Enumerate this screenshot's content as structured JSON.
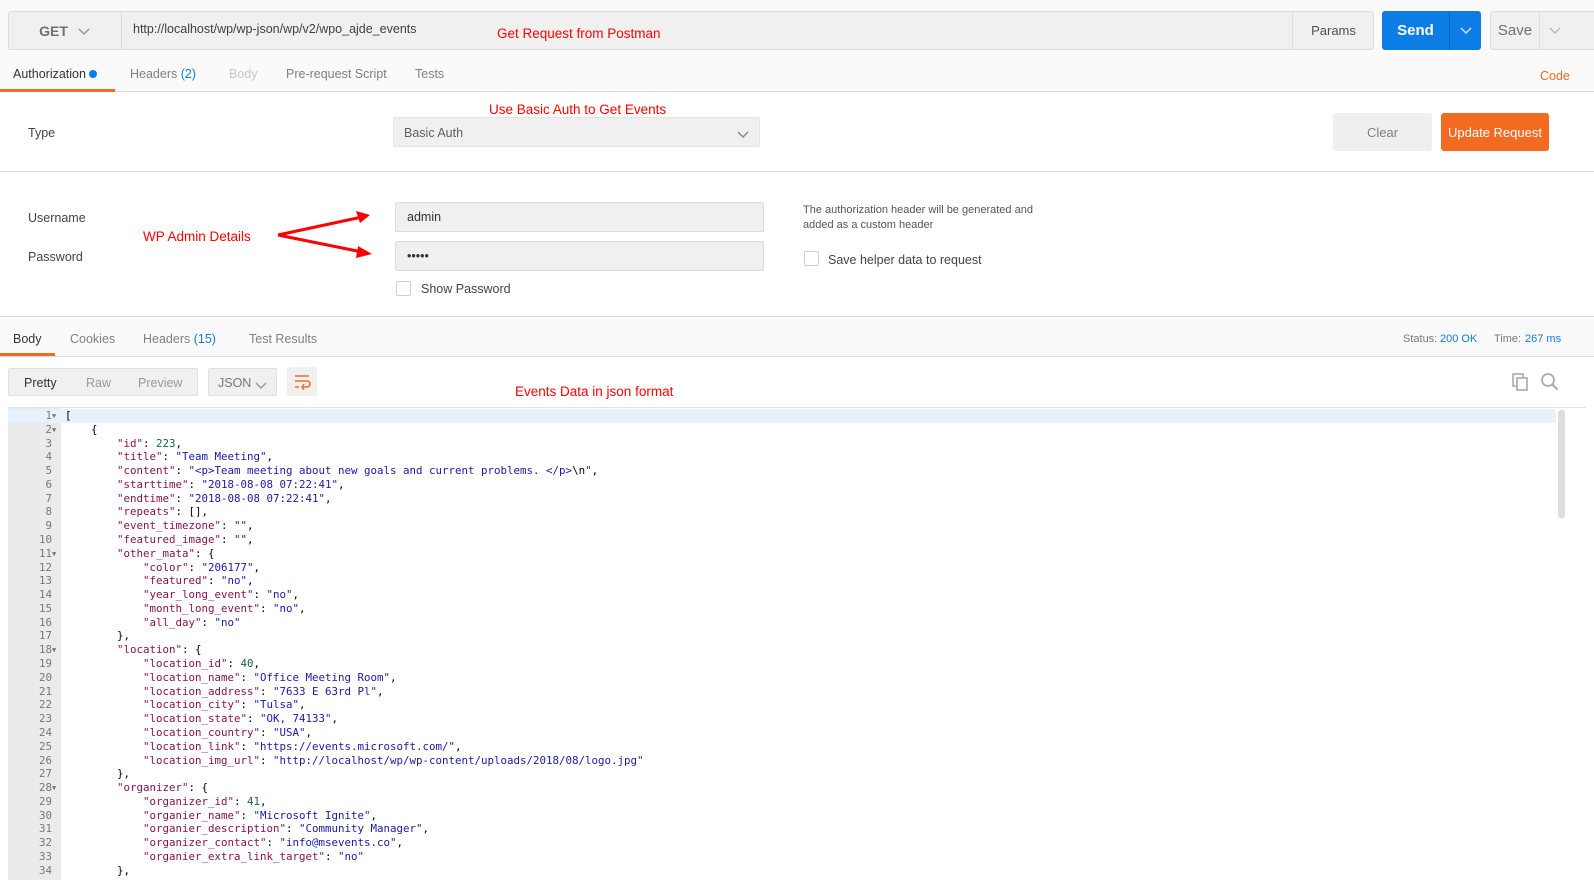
{
  "request": {
    "method": "GET",
    "url": "http://localhost/wp/wp-json/wp/v2/wpo_ajde_events",
    "params_label": "Params",
    "send_label": "Send",
    "save_label": "Save",
    "code_link": "Code"
  },
  "request_tabs": [
    {
      "label": "Authorization"
    },
    {
      "label": "Headers",
      "count": "(2)"
    },
    {
      "label": "Body"
    },
    {
      "label": "Pre-request Script"
    },
    {
      "label": "Tests"
    }
  ],
  "auth": {
    "type_label": "Type",
    "type_value": "Basic Auth",
    "clear_label": "Clear",
    "update_label": "Update Request",
    "username_label": "Username",
    "username_value": "admin",
    "password_label": "Password",
    "password_value": "•••••",
    "show_password_label": "Show Password",
    "helper_note": "The authorization header will be generated and added as a custom header",
    "save_helper_label": "Save helper data to request"
  },
  "annotations": {
    "top": "Get Request from Postman",
    "auth": "Use Basic Auth to Get Events",
    "admin": "WP Admin Details",
    "events": "Events Data in json format"
  },
  "response_tabs": [
    {
      "label": "Body"
    },
    {
      "label": "Cookies"
    },
    {
      "label": "Headers",
      "count": "(15)"
    },
    {
      "label": "Test Results"
    }
  ],
  "status": {
    "status_label": "Status:",
    "status_value": "200 OK",
    "time_label": "Time:",
    "time_value": "267 ms"
  },
  "view": {
    "modes": [
      "Pretty",
      "Raw",
      "Preview"
    ],
    "format": "JSON"
  },
  "colors": {
    "accent": "#f26b21",
    "primary": "#0d7de6",
    "annotation": "#ff0000"
  },
  "code": {
    "lines": [
      {
        "n": "1",
        "f": 1,
        "i": 0,
        "t": [
          [
            "p",
            "["
          ]
        ]
      },
      {
        "n": "2",
        "f": 1,
        "i": 1,
        "t": [
          [
            "p",
            "{"
          ]
        ]
      },
      {
        "n": "3",
        "i": 2,
        "t": [
          [
            "k",
            "\"id\""
          ],
          [
            "p",
            ": "
          ],
          [
            "n",
            "223"
          ],
          [
            "p",
            ","
          ]
        ]
      },
      {
        "n": "4",
        "i": 2,
        "t": [
          [
            "k",
            "\"title\""
          ],
          [
            "p",
            ": "
          ],
          [
            "s",
            "\"Team Meeting\""
          ],
          [
            "p",
            ","
          ]
        ]
      },
      {
        "n": "5",
        "i": 2,
        "t": [
          [
            "k",
            "\"content\""
          ],
          [
            "p",
            ": "
          ],
          [
            "s",
            "\"<p>Team meeting about new goals and current problems. </p>"
          ],
          [
            "p",
            "\\n"
          ],
          [
            "s",
            "\""
          ],
          [
            "p",
            ","
          ]
        ]
      },
      {
        "n": "6",
        "i": 2,
        "t": [
          [
            "k",
            "\"starttime\""
          ],
          [
            "p",
            ": "
          ],
          [
            "s",
            "\"2018-08-08 07:22:41\""
          ],
          [
            "p",
            ","
          ]
        ]
      },
      {
        "n": "7",
        "i": 2,
        "t": [
          [
            "k",
            "\"endtime\""
          ],
          [
            "p",
            ": "
          ],
          [
            "s",
            "\"2018-08-08 07:22:41\""
          ],
          [
            "p",
            ","
          ]
        ]
      },
      {
        "n": "8",
        "i": 2,
        "t": [
          [
            "k",
            "\"repeats\""
          ],
          [
            "p",
            ": [],"
          ]
        ]
      },
      {
        "n": "9",
        "i": 2,
        "t": [
          [
            "k",
            "\"event_timezone\""
          ],
          [
            "p",
            ": "
          ],
          [
            "s",
            "\"\""
          ],
          [
            "p",
            ","
          ]
        ]
      },
      {
        "n": "10",
        "i": 2,
        "t": [
          [
            "k",
            "\"featured_image\""
          ],
          [
            "p",
            ": "
          ],
          [
            "s",
            "\"\""
          ],
          [
            "p",
            ","
          ]
        ]
      },
      {
        "n": "11",
        "f": 1,
        "i": 2,
        "t": [
          [
            "k",
            "\"other_mata\""
          ],
          [
            "p",
            ": {"
          ]
        ]
      },
      {
        "n": "12",
        "i": 3,
        "t": [
          [
            "k",
            "\"color\""
          ],
          [
            "p",
            ": "
          ],
          [
            "s",
            "\"206177\""
          ],
          [
            "p",
            ","
          ]
        ]
      },
      {
        "n": "13",
        "i": 3,
        "t": [
          [
            "k",
            "\"featured\""
          ],
          [
            "p",
            ": "
          ],
          [
            "s",
            "\"no\""
          ],
          [
            "p",
            ","
          ]
        ]
      },
      {
        "n": "14",
        "i": 3,
        "t": [
          [
            "k",
            "\"year_long_event\""
          ],
          [
            "p",
            ": "
          ],
          [
            "s",
            "\"no\""
          ],
          [
            "p",
            ","
          ]
        ]
      },
      {
        "n": "15",
        "i": 3,
        "t": [
          [
            "k",
            "\"month_long_event\""
          ],
          [
            "p",
            ": "
          ],
          [
            "s",
            "\"no\""
          ],
          [
            "p",
            ","
          ]
        ]
      },
      {
        "n": "16",
        "i": 3,
        "t": [
          [
            "k",
            "\"all_day\""
          ],
          [
            "p",
            ": "
          ],
          [
            "s",
            "\"no\""
          ]
        ]
      },
      {
        "n": "17",
        "i": 2,
        "t": [
          [
            "p",
            "},"
          ]
        ]
      },
      {
        "n": "18",
        "f": 1,
        "i": 2,
        "t": [
          [
            "k",
            "\"location\""
          ],
          [
            "p",
            ": {"
          ]
        ]
      },
      {
        "n": "19",
        "i": 3,
        "t": [
          [
            "k",
            "\"location_id\""
          ],
          [
            "p",
            ": "
          ],
          [
            "n",
            "40"
          ],
          [
            "p",
            ","
          ]
        ]
      },
      {
        "n": "20",
        "i": 3,
        "t": [
          [
            "k",
            "\"location_name\""
          ],
          [
            "p",
            ": "
          ],
          [
            "s",
            "\"Office Meeting Room\""
          ],
          [
            "p",
            ","
          ]
        ]
      },
      {
        "n": "21",
        "i": 3,
        "t": [
          [
            "k",
            "\"location_address\""
          ],
          [
            "p",
            ": "
          ],
          [
            "s",
            "\"7633 E 63rd Pl\""
          ],
          [
            "p",
            ","
          ]
        ]
      },
      {
        "n": "22",
        "i": 3,
        "t": [
          [
            "k",
            "\"location_city\""
          ],
          [
            "p",
            ": "
          ],
          [
            "s",
            "\"Tulsa\""
          ],
          [
            "p",
            ","
          ]
        ]
      },
      {
        "n": "23",
        "i": 3,
        "t": [
          [
            "k",
            "\"location_state\""
          ],
          [
            "p",
            ": "
          ],
          [
            "s",
            "\"OK, 74133\""
          ],
          [
            "p",
            ","
          ]
        ]
      },
      {
        "n": "24",
        "i": 3,
        "t": [
          [
            "k",
            "\"location_country\""
          ],
          [
            "p",
            ": "
          ],
          [
            "s",
            "\"USA\""
          ],
          [
            "p",
            ","
          ]
        ]
      },
      {
        "n": "25",
        "i": 3,
        "t": [
          [
            "k",
            "\"location_link\""
          ],
          [
            "p",
            ": "
          ],
          [
            "s",
            "\"https://events.microsoft.com/\""
          ],
          [
            "p",
            ","
          ]
        ]
      },
      {
        "n": "26",
        "i": 3,
        "t": [
          [
            "k",
            "\"location_img_url\""
          ],
          [
            "p",
            ": "
          ],
          [
            "s",
            "\"http://localhost/wp/wp-content/uploads/2018/08/logo.jpg\""
          ]
        ]
      },
      {
        "n": "27",
        "i": 2,
        "t": [
          [
            "p",
            "},"
          ]
        ]
      },
      {
        "n": "28",
        "f": 1,
        "i": 2,
        "t": [
          [
            "k",
            "\"organizer\""
          ],
          [
            "p",
            ": {"
          ]
        ]
      },
      {
        "n": "29",
        "i": 3,
        "t": [
          [
            "k",
            "\"organizer_id\""
          ],
          [
            "p",
            ": "
          ],
          [
            "n",
            "41"
          ],
          [
            "p",
            ","
          ]
        ]
      },
      {
        "n": "30",
        "i": 3,
        "t": [
          [
            "k",
            "\"organier_name\""
          ],
          [
            "p",
            ": "
          ],
          [
            "s",
            "\"Microsoft Ignite\""
          ],
          [
            "p",
            ","
          ]
        ]
      },
      {
        "n": "31",
        "i": 3,
        "t": [
          [
            "k",
            "\"organier_description\""
          ],
          [
            "p",
            ": "
          ],
          [
            "s",
            "\"Community Manager\""
          ],
          [
            "p",
            ","
          ]
        ]
      },
      {
        "n": "32",
        "i": 3,
        "t": [
          [
            "k",
            "\"organizer_contact\""
          ],
          [
            "p",
            ": "
          ],
          [
            "s",
            "\"info@msevents.co\""
          ],
          [
            "p",
            ","
          ]
        ]
      },
      {
        "n": "33",
        "i": 3,
        "t": [
          [
            "k",
            "\"organier_extra_link_target\""
          ],
          [
            "p",
            ": "
          ],
          [
            "s",
            "\"no\""
          ]
        ]
      },
      {
        "n": "34",
        "i": 2,
        "t": [
          [
            "p",
            "},"
          ]
        ]
      }
    ]
  }
}
